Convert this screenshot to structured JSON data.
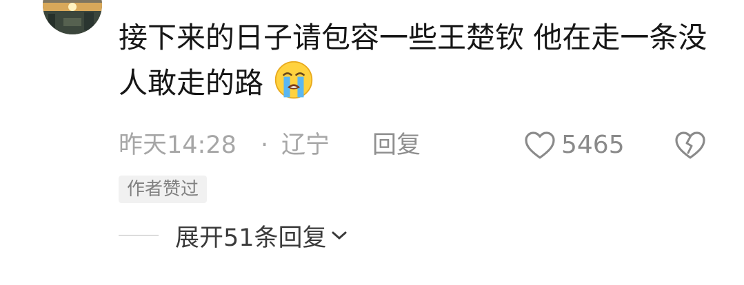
{
  "avatar": {
    "icon": "user-avatar-photo"
  },
  "comment": {
    "text": "接下来的日子请包容一些王楚钦 他在走一条没人敢走的路",
    "emoji": "loudly-crying-face-emoji"
  },
  "meta": {
    "time": "昨天14:28",
    "separator": "·",
    "location": "辽宁",
    "reply_label": "回复"
  },
  "like": {
    "icon": "heart-outline-icon",
    "count": "5465"
  },
  "dislike": {
    "icon": "broken-heart-icon"
  },
  "badge": {
    "label": "作者赞过"
  },
  "expand": {
    "label": "展开51条回复",
    "icon": "chevron-down-icon"
  },
  "colors": {
    "text": "#161616",
    "meta": "#a6a6a6",
    "badge_bg": "#f1f1f1"
  }
}
